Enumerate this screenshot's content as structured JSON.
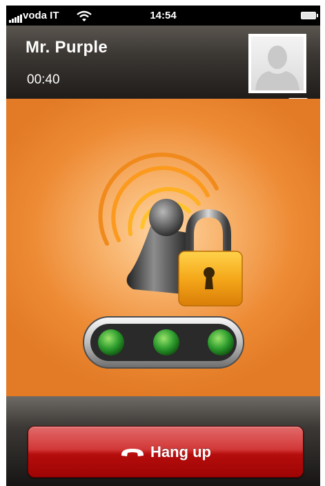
{
  "status_bar": {
    "carrier": "voda IT",
    "time": "14:54",
    "icons": [
      "signal-bars-icon",
      "wifi-icon",
      "battery-icon"
    ]
  },
  "call": {
    "caller_name": "Mr. Purple",
    "duration": "00:40",
    "avatar": "placeholder-person-icon",
    "verified": true
  },
  "security_indicator": {
    "icons": [
      "encrypted-call-icon",
      "padlock-icon"
    ],
    "lights": [
      "green",
      "green",
      "green"
    ]
  },
  "actions": {
    "hangup_label": "Hang up",
    "hangup_icon": "phone-handset-icon"
  },
  "colors": {
    "accent_orange": "#ed8a34",
    "hangup_red": "#c41a1a",
    "verified_green": "#1fa13e",
    "light_green": "#2f9e2f"
  }
}
